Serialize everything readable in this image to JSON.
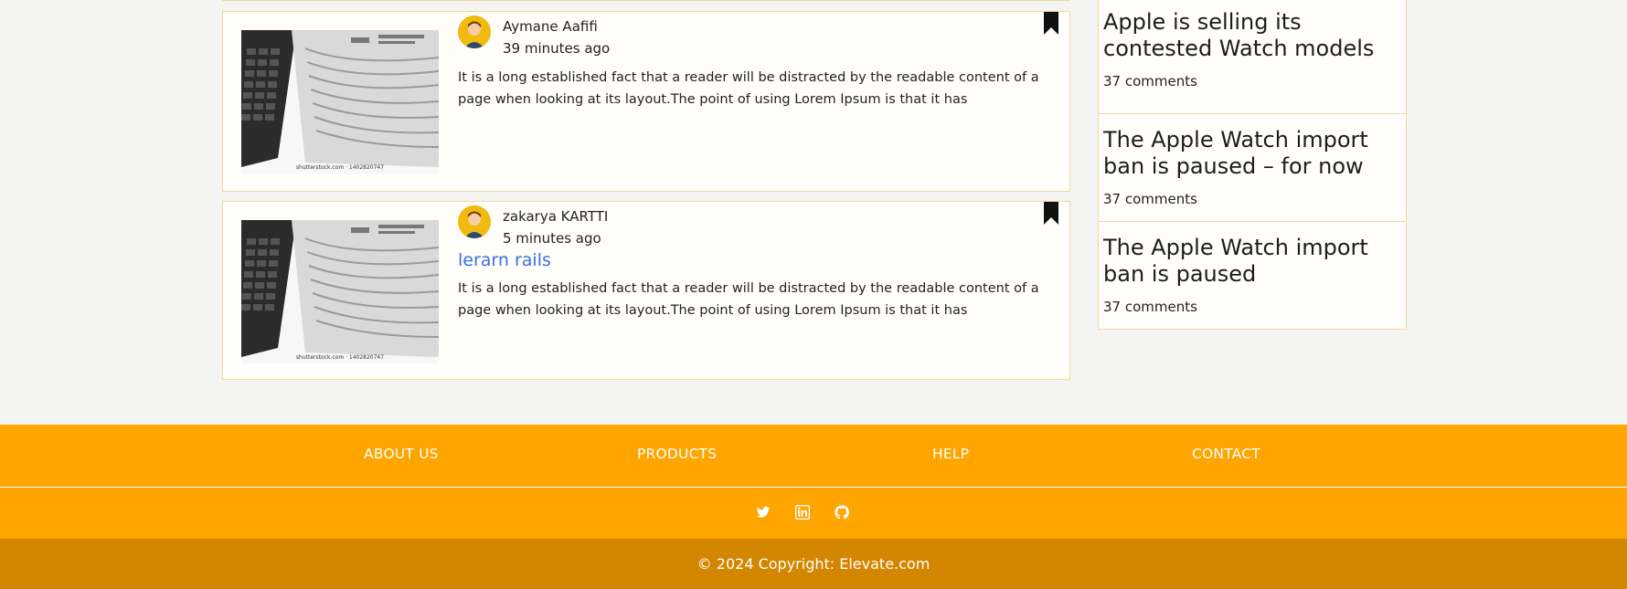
{
  "posts": [
    {
      "author": "Aymane Aafifi",
      "time": "39 minutes ago",
      "title": "",
      "excerpt": "It is a long established fact that a reader will be distracted by the readable content of a page when looking at its layout.The point of using Lorem Ipsum is that it has",
      "image_credit": "shutterstock.com · 1402820747"
    },
    {
      "author": "zakarya KARTTI",
      "time": "5 minutes ago",
      "title": "lerarn rails",
      "excerpt": "It is a long established fact that a reader will be distracted by the readable content of a page when looking at its layout.The point of using Lorem Ipsum is that it has",
      "image_credit": "shutterstock.com · 1402820747"
    }
  ],
  "sidebar": {
    "items": [
      {
        "title": "Apple is selling its contested Watch models",
        "comments": "37 comments"
      },
      {
        "title": "The Apple Watch import ban is paused – for now",
        "comments": "37 comments"
      },
      {
        "title": "The Apple Watch import ban is paused",
        "comments": "37 comments"
      }
    ]
  },
  "footer": {
    "nav": [
      "ABOUT US",
      "PRODUCTS",
      "HELP",
      "CONTACT"
    ],
    "social_icons": [
      "twitter-icon",
      "linkedin-icon",
      "github-icon"
    ],
    "copyright": "© 2024 Copyright: Elevate.com"
  },
  "colors": {
    "footer_orange": "#ffa500",
    "footer_dark_orange": "#d38600",
    "link_blue": "#3b6fe0",
    "card_border": "#f0d9a0",
    "page_bg": "#f4f4f2"
  }
}
